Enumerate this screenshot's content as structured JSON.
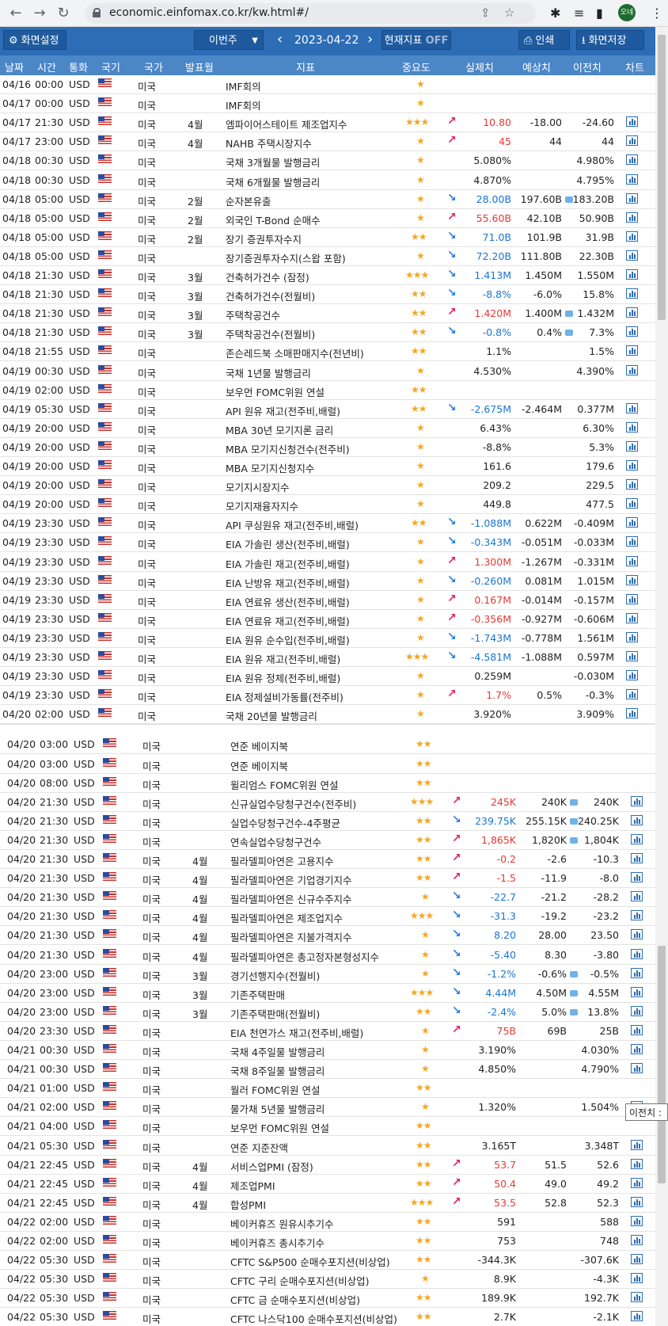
{
  "browser": {
    "url": "economic.einfomax.co.kr/kw.html#/",
    "avatar": "오네"
  },
  "toolbar": {
    "settings_label": "화면설정",
    "week_label": "이번주",
    "date": "2023-04-22",
    "now_label": "현재지표",
    "now_state": "OFF",
    "print_label": "인쇄",
    "save_label": "화면저장"
  },
  "columns": [
    "날짜",
    "시간",
    "통화",
    "국기",
    "국가",
    "발표월",
    "지표",
    "중요도",
    "실제치",
    "예상치",
    "이전치",
    "차트"
  ],
  "tooltip": "이전치 :",
  "rows": [
    [
      "04/16",
      "00:00",
      "USD",
      "미국",
      "",
      "IMF회의",
      "★",
      "",
      "",
      "",
      "",
      ""
    ],
    [
      "04/17",
      "00:00",
      "USD",
      "미국",
      "",
      "IMF회의",
      "★",
      "",
      "",
      "",
      "",
      ""
    ],
    [
      "04/17",
      "21:30",
      "USD",
      "미국",
      "4월",
      "엠파이어스테이트 제조업지수",
      "★★★",
      "up",
      "10.80",
      "-18.00",
      "-24.60",
      ""
    ],
    [
      "04/17",
      "23:00",
      "USD",
      "미국",
      "4월",
      "NAHB 주택시장지수",
      "★",
      "up",
      "45",
      "44",
      "44",
      ""
    ],
    [
      "04/18",
      "00:30",
      "USD",
      "미국",
      "",
      "국채 3개월물 발행금리",
      "★",
      "",
      "5.080%",
      "",
      "4.980%",
      ""
    ],
    [
      "04/18",
      "00:30",
      "USD",
      "미국",
      "",
      "국채 6개월물 발행금리",
      "★",
      "",
      "4.870%",
      "",
      "4.795%",
      ""
    ],
    [
      "04/18",
      "05:00",
      "USD",
      "미국",
      "2월",
      "순자본유출",
      "★",
      "dn",
      "28.00B",
      "197.60B",
      "183.20B",
      "b"
    ],
    [
      "04/18",
      "05:00",
      "USD",
      "미국",
      "2월",
      "외국인 T-Bond 순매수",
      "★",
      "up",
      "55.60B",
      "42.10B",
      "50.90B",
      ""
    ],
    [
      "04/18",
      "05:00",
      "USD",
      "미국",
      "2월",
      "장기 증권투자수지",
      "★★",
      "dn",
      "71.0B",
      "101.9B",
      "31.9B",
      ""
    ],
    [
      "04/18",
      "05:00",
      "USD",
      "미국",
      "",
      "장기증권투자수지(스왑 포함)",
      "★",
      "dn",
      "72.20B",
      "111.80B",
      "22.30B",
      ""
    ],
    [
      "04/18",
      "21:30",
      "USD",
      "미국",
      "3월",
      "건축허가건수 (잠정)",
      "★★★",
      "dn",
      "1.413M",
      "1.450M",
      "1.550M",
      ""
    ],
    [
      "04/18",
      "21:30",
      "USD",
      "미국",
      "3월",
      "건축허가건수(전월비)",
      "★★",
      "dn",
      "-8.8%",
      "-6.0%",
      "15.8%",
      ""
    ],
    [
      "04/18",
      "21:30",
      "USD",
      "미국",
      "3월",
      "주택착공건수",
      "★★",
      "up",
      "1.420M",
      "1.400M",
      "1.432M",
      "b"
    ],
    [
      "04/18",
      "21:30",
      "USD",
      "미국",
      "3월",
      "주택착공건수(전월비)",
      "★★",
      "dn",
      "-0.8%",
      "0.4%",
      "7.3%",
      "b"
    ],
    [
      "04/18",
      "21:55",
      "USD",
      "미국",
      "",
      "존슨레드북 소매판매지수(전년비)",
      "★★",
      "",
      "1.1%",
      "",
      "1.5%",
      ""
    ],
    [
      "04/19",
      "00:30",
      "USD",
      "미국",
      "",
      "국채 1년물 발행금리",
      "★",
      "",
      "4.530%",
      "",
      "4.390%",
      ""
    ],
    [
      "04/19",
      "02:00",
      "USD",
      "미국",
      "",
      "보우먼 FOMC위원 연설",
      "★★",
      "",
      "",
      "",
      "",
      ""
    ],
    [
      "04/19",
      "05:30",
      "USD",
      "미국",
      "",
      "API 원유 재고(전주비,배럴)",
      "★★",
      "dn",
      "-2.675M",
      "-2.464M",
      "0.377M",
      ""
    ],
    [
      "04/19",
      "20:00",
      "USD",
      "미국",
      "",
      "MBA 30년 모기지론 금리",
      "★",
      "",
      "6.43%",
      "",
      "6.30%",
      ""
    ],
    [
      "04/19",
      "20:00",
      "USD",
      "미국",
      "",
      "MBA 모기지신청건수(전주비)",
      "★",
      "",
      "-8.8%",
      "",
      "5.3%",
      ""
    ],
    [
      "04/19",
      "20:00",
      "USD",
      "미국",
      "",
      "MBA 모기지신청지수",
      "★",
      "",
      "161.6",
      "",
      "179.6",
      ""
    ],
    [
      "04/19",
      "20:00",
      "USD",
      "미국",
      "",
      "모기지시장지수",
      "★",
      "",
      "209.2",
      "",
      "229.5",
      ""
    ],
    [
      "04/19",
      "20:00",
      "USD",
      "미국",
      "",
      "모기지재융자지수",
      "★",
      "",
      "449.8",
      "",
      "477.5",
      ""
    ],
    [
      "04/19",
      "23:30",
      "USD",
      "미국",
      "",
      "API 쿠싱원유 재고(전주비,배럴)",
      "★★",
      "dn",
      "-1.088M",
      "0.622M",
      "-0.409M",
      ""
    ],
    [
      "04/19",
      "23:30",
      "USD",
      "미국",
      "",
      "EIA 가솔린 생산(전주비,배럴)",
      "★",
      "dn",
      "-0.343M",
      "-0.051M",
      "-0.033M",
      ""
    ],
    [
      "04/19",
      "23:30",
      "USD",
      "미국",
      "",
      "EIA 가솔린 재고(전주비,배럴)",
      "★",
      "up",
      "1.300M",
      "-1.267M",
      "-0.331M",
      ""
    ],
    [
      "04/19",
      "23:30",
      "USD",
      "미국",
      "",
      "EIA 난방유 재고(전주비,배럴)",
      "★",
      "dn",
      "-0.260M",
      "0.081M",
      "1.015M",
      ""
    ],
    [
      "04/19",
      "23:30",
      "USD",
      "미국",
      "",
      "EIA 연료유 생산(전주비,배럴)",
      "★",
      "up",
      "0.167M",
      "-0.014M",
      "-0.157M",
      ""
    ],
    [
      "04/19",
      "23:30",
      "USD",
      "미국",
      "",
      "EIA 연료유 재고(전주비,배럴)",
      "★",
      "up",
      "-0.356M",
      "-0.927M",
      "-0.606M",
      ""
    ],
    [
      "04/19",
      "23:30",
      "USD",
      "미국",
      "",
      "EIA 원유 순수입(전주비,배럴)",
      "★",
      "dn",
      "-1.743M",
      "-0.778M",
      "1.561M",
      ""
    ],
    [
      "04/19",
      "23:30",
      "USD",
      "미국",
      "",
      "EIA 원유 재고(전주비,배럴)",
      "★★★",
      "dn",
      "-4.581M",
      "-1.088M",
      "0.597M",
      ""
    ],
    [
      "04/19",
      "23:30",
      "USD",
      "미국",
      "",
      "EIA 원유 정제(전주비,배럴)",
      "★",
      "",
      "0.259M",
      "",
      "-0.030M",
      ""
    ],
    [
      "04/19",
      "23:30",
      "USD",
      "미국",
      "",
      "EIA 정제설비가동률(전주비)",
      "★",
      "up",
      "1.7%",
      "0.5%",
      "-0.3%",
      ""
    ],
    [
      "04/20",
      "02:00",
      "USD",
      "미국",
      "",
      "국채 20년물 발행금리",
      "★",
      "",
      "3.920%",
      "",
      "3.909%",
      ""
    ],
    [
      "04/20",
      "03:00",
      "USD",
      "미국",
      "",
      "연준 베이지북",
      "★★",
      "",
      "",
      "",
      "",
      ""
    ],
    [
      "04/20",
      "03:00",
      "USD",
      "미국",
      "",
      "연준 베이지북",
      "★★",
      "",
      "",
      "",
      "",
      ""
    ],
    [
      "04/20",
      "08:00",
      "USD",
      "미국",
      "",
      "윌리엄스 FOMC위원 연설",
      "★★",
      "",
      "",
      "",
      "",
      ""
    ],
    [
      "04/20",
      "21:30",
      "USD",
      "미국",
      "",
      "신규실업수당청구건수(전주비)",
      "★★★",
      "up",
      "245K",
      "240K",
      "240K",
      "b"
    ],
    [
      "04/20",
      "21:30",
      "USD",
      "미국",
      "",
      "실업수당청구건수-4주평균",
      "★★",
      "dn",
      "239.75K",
      "255.15K",
      "240.25K",
      "b"
    ],
    [
      "04/20",
      "21:30",
      "USD",
      "미국",
      "",
      "연속실업수당청구건수",
      "★★",
      "up",
      "1,865K",
      "1,820K",
      "1,804K",
      "b"
    ],
    [
      "04/20",
      "21:30",
      "USD",
      "미국",
      "4월",
      "필라델피아연은 고용지수",
      "★★",
      "up",
      "-0.2",
      "-2.6",
      "-10.3",
      ""
    ],
    [
      "04/20",
      "21:30",
      "USD",
      "미국",
      "4월",
      "필라델피아연은 기업경기지수",
      "★★",
      "up",
      "-1.5",
      "-11.9",
      "-8.0",
      ""
    ],
    [
      "04/20",
      "21:30",
      "USD",
      "미국",
      "4월",
      "필라델피아연은 신규수주지수",
      "★",
      "dn",
      "-22.7",
      "-21.2",
      "-28.2",
      ""
    ],
    [
      "04/20",
      "21:30",
      "USD",
      "미국",
      "4월",
      "필라델피아연은 제조업지수",
      "★★★",
      "dn",
      "-31.3",
      "-19.2",
      "-23.2",
      ""
    ],
    [
      "04/20",
      "21:30",
      "USD",
      "미국",
      "4월",
      "필라델피아연은 지불가격지수",
      "★",
      "dn",
      "8.20",
      "28.00",
      "23.50",
      ""
    ],
    [
      "04/20",
      "21:30",
      "USD",
      "미국",
      "4월",
      "필라델피아연은 총고정자본형성지수",
      "★",
      "dn",
      "-5.40",
      "8.30",
      "-3.80",
      ""
    ],
    [
      "04/20",
      "23:00",
      "USD",
      "미국",
      "3월",
      "경기선행지수(전월비)",
      "★",
      "dn",
      "-1.2%",
      "-0.6%",
      "-0.5%",
      "b"
    ],
    [
      "04/20",
      "23:00",
      "USD",
      "미국",
      "3월",
      "기존주택판매",
      "★★★",
      "dn",
      "4.44M",
      "4.50M",
      "4.55M",
      "b"
    ],
    [
      "04/20",
      "23:00",
      "USD",
      "미국",
      "3월",
      "기존주택판매(전월비)",
      "★★",
      "dn",
      "-2.4%",
      "5.0%",
      "13.8%",
      "b"
    ],
    [
      "04/20",
      "23:30",
      "USD",
      "미국",
      "",
      "EIA 천연가스 재고(전주비,배럴)",
      "★",
      "up",
      "75B",
      "69B",
      "25B",
      ""
    ],
    [
      "04/21",
      "00:30",
      "USD",
      "미국",
      "",
      "국채 4주일물 발행금리",
      "★",
      "",
      "3.190%",
      "",
      "4.030%",
      ""
    ],
    [
      "04/21",
      "00:30",
      "USD",
      "미국",
      "",
      "국채 8주일물 발행금리",
      "★",
      "",
      "4.850%",
      "",
      "4.790%",
      ""
    ],
    [
      "04/21",
      "01:00",
      "USD",
      "미국",
      "",
      "월러 FOMC위원 연설",
      "★★",
      "",
      "",
      "",
      "",
      ""
    ],
    [
      "04/21",
      "02:00",
      "USD",
      "미국",
      "",
      "물가채 5년물 발행금리",
      "★",
      "",
      "1.320%",
      "",
      "1.504%",
      ""
    ],
    [
      "04/21",
      "04:00",
      "USD",
      "미국",
      "",
      "보우먼 FOMC위원 연설",
      "★★",
      "",
      "",
      "",
      "",
      ""
    ],
    [
      "04/21",
      "05:30",
      "USD",
      "미국",
      "",
      "연준 지준잔액",
      "★★",
      "",
      "3.165T",
      "",
      "3.348T",
      ""
    ],
    [
      "04/21",
      "22:45",
      "USD",
      "미국",
      "4월",
      "서비스업PMI (잠정)",
      "★★",
      "up",
      "53.7",
      "51.5",
      "52.6",
      ""
    ],
    [
      "04/21",
      "22:45",
      "USD",
      "미국",
      "4월",
      "제조업PMI",
      "★★",
      "up",
      "50.4",
      "49.0",
      "49.2",
      ""
    ],
    [
      "04/21",
      "22:45",
      "USD",
      "미국",
      "4월",
      "합성PMI",
      "★★★",
      "up",
      "53.5",
      "52.8",
      "52.3",
      ""
    ],
    [
      "04/22",
      "02:00",
      "USD",
      "미국",
      "",
      "베이커휴즈 원유시추기수",
      "★★",
      "",
      "591",
      "",
      "588",
      ""
    ],
    [
      "04/22",
      "02:00",
      "USD",
      "미국",
      "",
      "베이커휴즈 총시추기수",
      "★★",
      "",
      "753",
      "",
      "748",
      ""
    ],
    [
      "04/22",
      "05:30",
      "USD",
      "미국",
      "",
      "CFTC S&P500 순매수포지션(비상업)",
      "★★",
      "",
      "-344.3K",
      "",
      "-307.6K",
      ""
    ],
    [
      "04/22",
      "05:30",
      "USD",
      "미국",
      "",
      "CFTC 구리 순매수포지션(비상업)",
      "★",
      "",
      "8.9K",
      "",
      "-4.3K",
      ""
    ],
    [
      "04/22",
      "05:30",
      "USD",
      "미국",
      "",
      "CFTC 금 순매수포지션(비상업)",
      "★★",
      "",
      "189.9K",
      "",
      "192.7K",
      ""
    ],
    [
      "04/22",
      "05:30",
      "USD",
      "미국",
      "",
      "CFTC 나스닥100 순매수포지션(비상업)",
      "★★",
      "",
      "2.7K",
      "",
      "-2.1K",
      ""
    ]
  ]
}
